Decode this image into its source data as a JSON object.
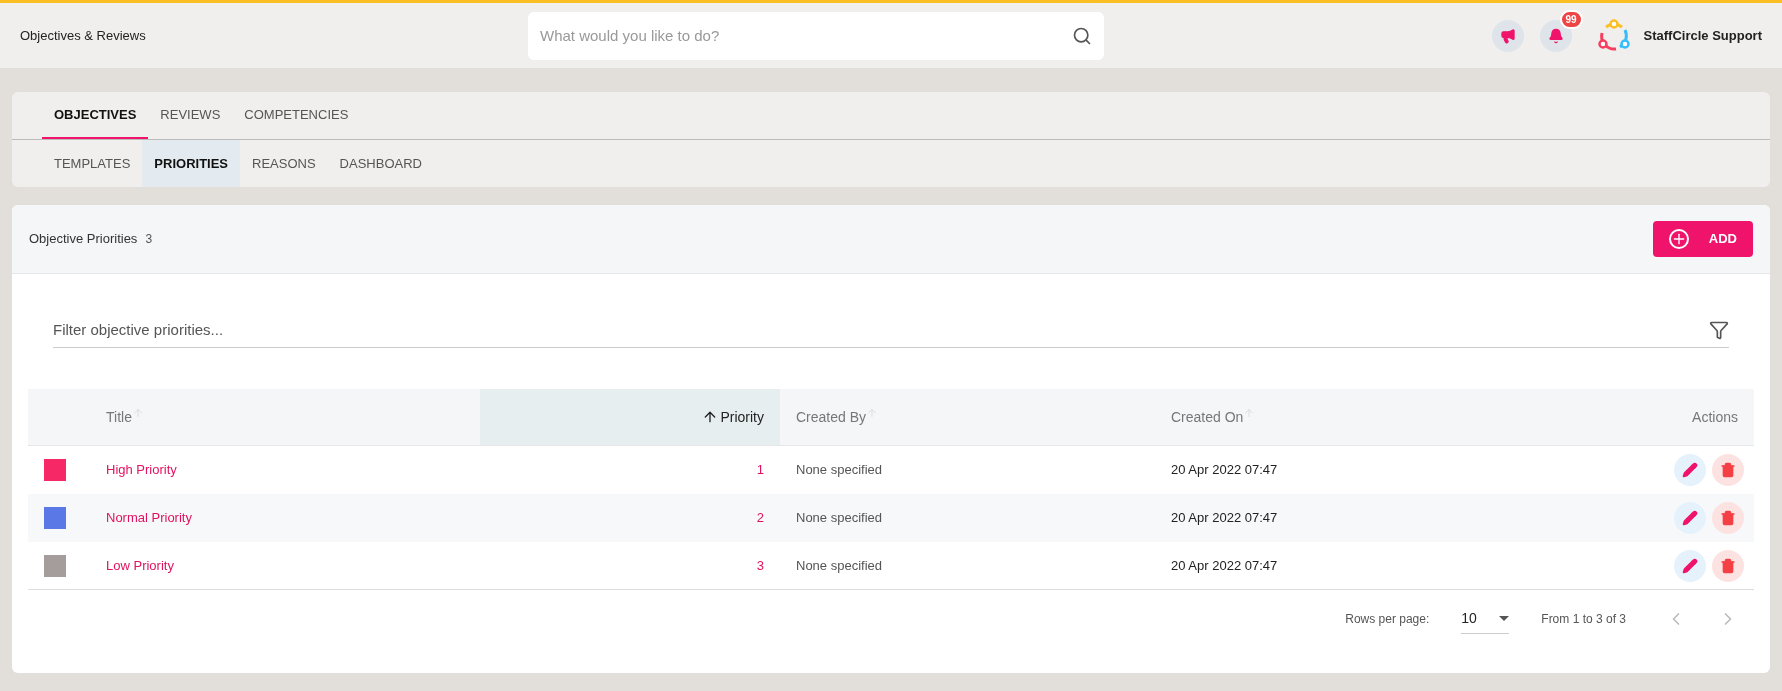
{
  "header": {
    "title": "Objectives & Reviews",
    "search": {
      "placeholder": "What would you like to do?"
    },
    "notification_count": "99",
    "user": "StaffCircle Support"
  },
  "tabs": [
    {
      "label": "OBJECTIVES",
      "selected": true
    },
    {
      "label": "REVIEWS",
      "selected": false
    },
    {
      "label": "COMPETENCIES",
      "selected": false
    }
  ],
  "subtabs": [
    {
      "label": "TEMPLATES",
      "selected": false
    },
    {
      "label": "PRIORITIES",
      "selected": true
    },
    {
      "label": "REASONS",
      "selected": false
    },
    {
      "label": "DASHBOARD",
      "selected": false
    }
  ],
  "panel": {
    "title": "Objective Priorities",
    "count": "3",
    "add_button": "ADD",
    "filter": {
      "placeholder": "Filter objective priorities..."
    }
  },
  "table": {
    "columns": [
      {
        "label": "Title",
        "sorted": false
      },
      {
        "label": "Priority",
        "sorted": true
      },
      {
        "label": "Created By",
        "sorted": false
      },
      {
        "label": "Created On",
        "sorted": false
      },
      {
        "label": "Actions",
        "sorted": false
      }
    ],
    "rows": [
      {
        "color": "#f72866",
        "title": "High Priority",
        "priority": "1",
        "created_by": "None specified",
        "created_on": "20 Apr 2022 07:47"
      },
      {
        "color": "#5a78e6",
        "title": "Normal Priority",
        "priority": "2",
        "created_by": "None specified",
        "created_on": "20 Apr 2022 07:47"
      },
      {
        "color": "#a59c9c",
        "title": "Low Priority",
        "priority": "3",
        "created_by": "None specified",
        "created_on": "20 Apr 2022 07:47"
      }
    ]
  },
  "pagination": {
    "rows_per_page_label": "Rows per page:",
    "rows_per_page": "10",
    "range": "From 1 to 3 of 3"
  }
}
